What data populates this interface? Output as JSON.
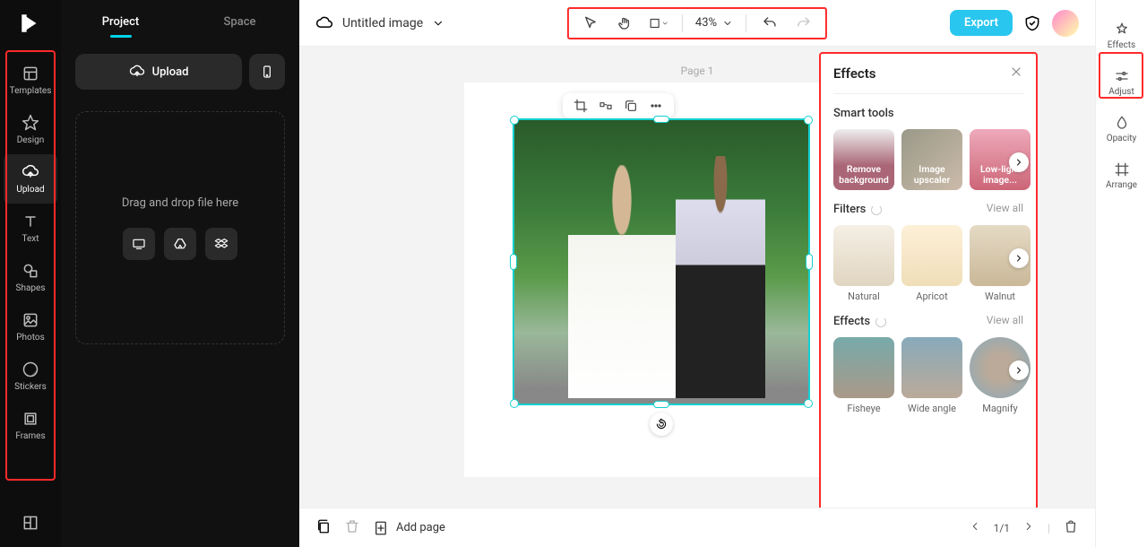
{
  "sidebar": {
    "tabs": {
      "project": "Project",
      "space": "Space"
    },
    "upload_label": "Upload",
    "dropzone_text": "Drag and drop file here"
  },
  "rail": {
    "items": [
      {
        "label": "Templates"
      },
      {
        "label": "Design"
      },
      {
        "label": "Upload"
      },
      {
        "label": "Text"
      },
      {
        "label": "Shapes"
      },
      {
        "label": "Photos"
      },
      {
        "label": "Stickers"
      },
      {
        "label": "Frames"
      }
    ]
  },
  "topbar": {
    "doc_title": "Untitled image",
    "zoom": "43%",
    "export_label": "Export"
  },
  "canvas": {
    "page_label": "Page 1"
  },
  "effects": {
    "title": "Effects",
    "smart_tools_label": "Smart tools",
    "smart_tools": [
      {
        "caption": "Remove background"
      },
      {
        "caption": "Image upscaler"
      },
      {
        "caption": "Low-light image..."
      }
    ],
    "filters_label": "Filters",
    "view_all": "View all",
    "filters": [
      {
        "label": "Natural"
      },
      {
        "label": "Apricot"
      },
      {
        "label": "Walnut"
      }
    ],
    "effects_label": "Effects",
    "effects_items": [
      {
        "label": "Fisheye"
      },
      {
        "label": "Wide angle"
      },
      {
        "label": "Magnify"
      }
    ]
  },
  "right_rail": {
    "items": [
      {
        "label": "Effects"
      },
      {
        "label": "Adjust"
      },
      {
        "label": "Opacity"
      },
      {
        "label": "Arrange"
      }
    ]
  },
  "bottom": {
    "add_page": "Add page",
    "pager": "1/1"
  }
}
